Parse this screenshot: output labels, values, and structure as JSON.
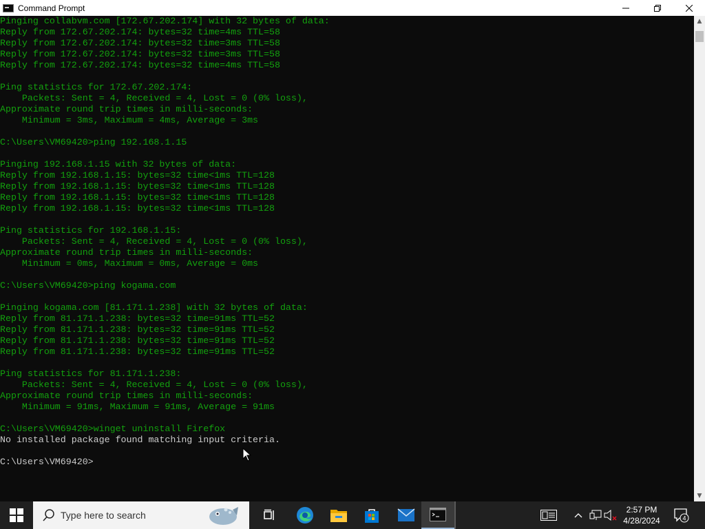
{
  "window": {
    "title": "Command Prompt",
    "minimize_glyph": "—",
    "restore_glyph": "❐",
    "close_glyph": "✕"
  },
  "console": {
    "lines": [
      {
        "text": "Pinging collabvm.com [172.67.202.174] with 32 bytes of data:",
        "color": "#13a10e"
      },
      {
        "text": "Reply from 172.67.202.174: bytes=32 time=4ms TTL=58",
        "color": "#13a10e"
      },
      {
        "text": "Reply from 172.67.202.174: bytes=32 time=3ms TTL=58",
        "color": "#13a10e"
      },
      {
        "text": "Reply from 172.67.202.174: bytes=32 time=3ms TTL=58",
        "color": "#13a10e"
      },
      {
        "text": "Reply from 172.67.202.174: bytes=32 time=4ms TTL=58",
        "color": "#13a10e"
      },
      {
        "text": "",
        "color": "#13a10e"
      },
      {
        "text": "Ping statistics for 172.67.202.174:",
        "color": "#13a10e"
      },
      {
        "text": "    Packets: Sent = 4, Received = 4, Lost = 0 (0% loss),",
        "color": "#13a10e"
      },
      {
        "text": "Approximate round trip times in milli-seconds:",
        "color": "#13a10e"
      },
      {
        "text": "    Minimum = 3ms, Maximum = 4ms, Average = 3ms",
        "color": "#13a10e"
      },
      {
        "text": "",
        "color": "#13a10e"
      },
      {
        "text": "C:\\Users\\VM69420>ping 192.168.1.15",
        "color": "#13a10e"
      },
      {
        "text": "",
        "color": "#13a10e"
      },
      {
        "text": "Pinging 192.168.1.15 with 32 bytes of data:",
        "color": "#13a10e"
      },
      {
        "text": "Reply from 192.168.1.15: bytes=32 time<1ms TTL=128",
        "color": "#13a10e"
      },
      {
        "text": "Reply from 192.168.1.15: bytes=32 time<1ms TTL=128",
        "color": "#13a10e"
      },
      {
        "text": "Reply from 192.168.1.15: bytes=32 time<1ms TTL=128",
        "color": "#13a10e"
      },
      {
        "text": "Reply from 192.168.1.15: bytes=32 time<1ms TTL=128",
        "color": "#13a10e"
      },
      {
        "text": "",
        "color": "#13a10e"
      },
      {
        "text": "Ping statistics for 192.168.1.15:",
        "color": "#13a10e"
      },
      {
        "text": "    Packets: Sent = 4, Received = 4, Lost = 0 (0% loss),",
        "color": "#13a10e"
      },
      {
        "text": "Approximate round trip times in milli-seconds:",
        "color": "#13a10e"
      },
      {
        "text": "    Minimum = 0ms, Maximum = 0ms, Average = 0ms",
        "color": "#13a10e"
      },
      {
        "text": "",
        "color": "#13a10e"
      },
      {
        "text": "C:\\Users\\VM69420>ping kogama.com",
        "color": "#13a10e"
      },
      {
        "text": "",
        "color": "#13a10e"
      },
      {
        "text": "Pinging kogama.com [81.171.1.238] with 32 bytes of data:",
        "color": "#13a10e"
      },
      {
        "text": "Reply from 81.171.1.238: bytes=32 time=91ms TTL=52",
        "color": "#13a10e"
      },
      {
        "text": "Reply from 81.171.1.238: bytes=32 time=91ms TTL=52",
        "color": "#13a10e"
      },
      {
        "text": "Reply from 81.171.1.238: bytes=32 time=91ms TTL=52",
        "color": "#13a10e"
      },
      {
        "text": "Reply from 81.171.1.238: bytes=32 time=91ms TTL=52",
        "color": "#13a10e"
      },
      {
        "text": "",
        "color": "#13a10e"
      },
      {
        "text": "Ping statistics for 81.171.1.238:",
        "color": "#13a10e"
      },
      {
        "text": "    Packets: Sent = 4, Received = 4, Lost = 0 (0% loss),",
        "color": "#13a10e"
      },
      {
        "text": "Approximate round trip times in milli-seconds:",
        "color": "#13a10e"
      },
      {
        "text": "    Minimum = 91ms, Maximum = 91ms, Average = 91ms",
        "color": "#13a10e"
      },
      {
        "text": "",
        "color": "#13a10e"
      },
      {
        "text": "C:\\Users\\VM69420>winget uninstall Firefox",
        "color": "#13a10e"
      },
      {
        "text": "No installed package found matching input criteria.",
        "color": "#cccccc"
      },
      {
        "text": "",
        "color": "#13a10e"
      },
      {
        "text": "C:\\Users\\VM69420>",
        "color": "#cccccc"
      }
    ]
  },
  "taskbar": {
    "search_placeholder": "Type here to search",
    "apps": [
      "edge-icon",
      "file-explorer-icon",
      "store-icon",
      "mail-icon",
      "command-prompt-icon"
    ],
    "clock_time": "2:57 PM",
    "clock_date": "4/28/2024",
    "notification_count": "4"
  }
}
